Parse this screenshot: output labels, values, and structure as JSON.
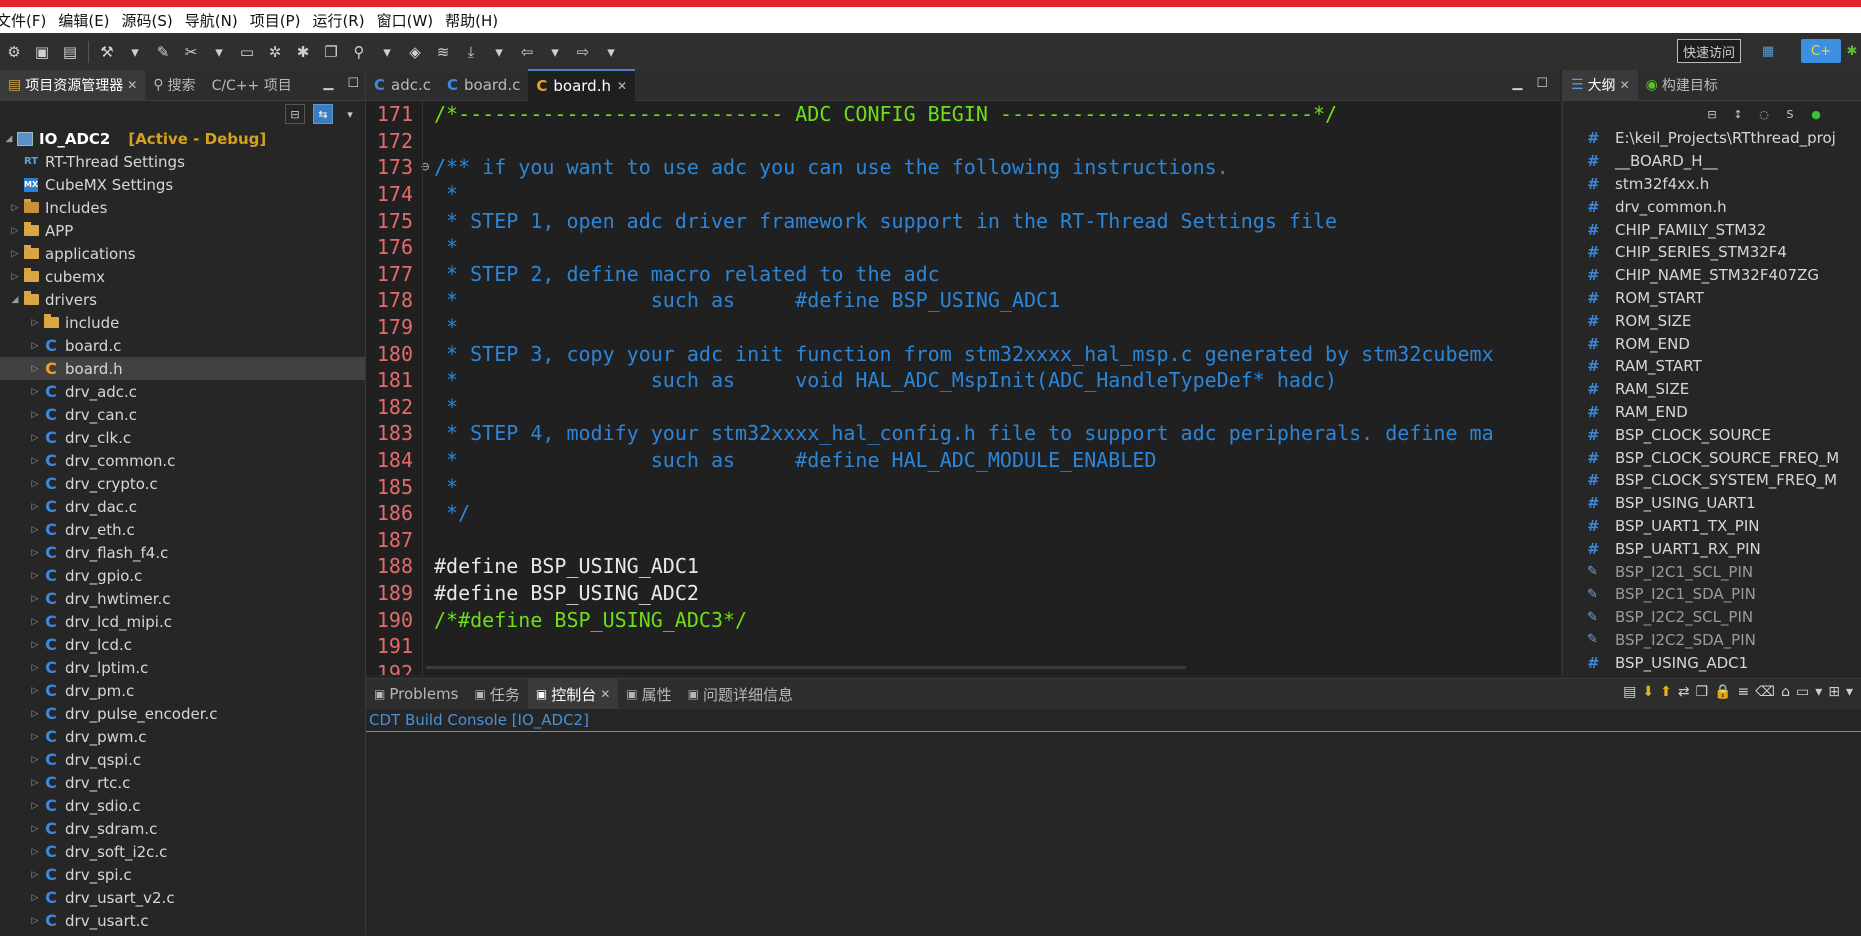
{
  "menu": [
    "文件(F)",
    "编辑(E)",
    "源码(S)",
    "导航(N)",
    "项目(P)",
    "运行(R)",
    "窗口(W)",
    "帮助(H)"
  ],
  "toolbar": {
    "quick_access": "快速访问"
  },
  "left_panel": {
    "tabs": [
      {
        "label": "项目资源管理器",
        "active": true
      },
      {
        "label": "搜索",
        "active": false
      },
      {
        "label": "C/C++ 项目",
        "active": false
      }
    ],
    "project": {
      "name": "IO_ADC2",
      "status": "[Active - Debug]"
    },
    "tree": [
      {
        "label": "RT-Thread Settings",
        "icon": "rt-thread-icon",
        "depth": 1,
        "arrow": ""
      },
      {
        "label": "CubeMX Settings",
        "icon": "cubemx-icon",
        "depth": 1,
        "arrow": ""
      },
      {
        "label": "Includes",
        "icon": "includes-icon",
        "depth": 1,
        "arrow": "▷"
      },
      {
        "label": "APP",
        "icon": "folder-icon",
        "depth": 1,
        "arrow": "▷"
      },
      {
        "label": "applications",
        "icon": "folder-icon",
        "depth": 1,
        "arrow": "▷"
      },
      {
        "label": "cubemx",
        "icon": "folder-icon",
        "depth": 1,
        "arrow": "▷"
      },
      {
        "label": "drivers",
        "icon": "folder-icon",
        "depth": 1,
        "arrow": "◢"
      },
      {
        "label": "include",
        "icon": "folder-icon",
        "depth": 2,
        "arrow": "▷"
      },
      {
        "label": "board.c",
        "icon": "c-file-icon",
        "depth": 2,
        "arrow": "▷"
      },
      {
        "label": "board.h",
        "icon": "h-file-icon",
        "depth": 2,
        "arrow": "▷",
        "selected": true
      },
      {
        "label": "drv_adc.c",
        "icon": "c-file-icon",
        "depth": 2,
        "arrow": "▷"
      },
      {
        "label": "drv_can.c",
        "icon": "c-file-icon",
        "depth": 2,
        "arrow": "▷"
      },
      {
        "label": "drv_clk.c",
        "icon": "c-file-icon",
        "depth": 2,
        "arrow": "▷"
      },
      {
        "label": "drv_common.c",
        "icon": "c-file-icon",
        "depth": 2,
        "arrow": "▷"
      },
      {
        "label": "drv_crypto.c",
        "icon": "c-file-icon",
        "depth": 2,
        "arrow": "▷"
      },
      {
        "label": "drv_dac.c",
        "icon": "c-file-icon",
        "depth": 2,
        "arrow": "▷"
      },
      {
        "label": "drv_eth.c",
        "icon": "c-file-icon",
        "depth": 2,
        "arrow": "▷"
      },
      {
        "label": "drv_flash_f4.c",
        "icon": "c-file-icon",
        "depth": 2,
        "arrow": "▷"
      },
      {
        "label": "drv_gpio.c",
        "icon": "c-file-icon",
        "depth": 2,
        "arrow": "▷"
      },
      {
        "label": "drv_hwtimer.c",
        "icon": "c-file-icon",
        "depth": 2,
        "arrow": "▷"
      },
      {
        "label": "drv_lcd_mipi.c",
        "icon": "c-file-icon",
        "depth": 2,
        "arrow": "▷"
      },
      {
        "label": "drv_lcd.c",
        "icon": "c-file-icon",
        "depth": 2,
        "arrow": "▷"
      },
      {
        "label": "drv_lptim.c",
        "icon": "c-file-icon",
        "depth": 2,
        "arrow": "▷"
      },
      {
        "label": "drv_pm.c",
        "icon": "c-file-icon",
        "depth": 2,
        "arrow": "▷"
      },
      {
        "label": "drv_pulse_encoder.c",
        "icon": "c-file-icon",
        "depth": 2,
        "arrow": "▷"
      },
      {
        "label": "drv_pwm.c",
        "icon": "c-file-icon",
        "depth": 2,
        "arrow": "▷"
      },
      {
        "label": "drv_qspi.c",
        "icon": "c-file-icon",
        "depth": 2,
        "arrow": "▷"
      },
      {
        "label": "drv_rtc.c",
        "icon": "c-file-icon",
        "depth": 2,
        "arrow": "▷"
      },
      {
        "label": "drv_sdio.c",
        "icon": "c-file-icon",
        "depth": 2,
        "arrow": "▷"
      },
      {
        "label": "drv_sdram.c",
        "icon": "c-file-icon",
        "depth": 2,
        "arrow": "▷"
      },
      {
        "label": "drv_soft_i2c.c",
        "icon": "c-file-icon",
        "depth": 2,
        "arrow": "▷"
      },
      {
        "label": "drv_spi.c",
        "icon": "c-file-icon",
        "depth": 2,
        "arrow": "▷"
      },
      {
        "label": "drv_usart_v2.c",
        "icon": "c-file-icon",
        "depth": 2,
        "arrow": "▷"
      },
      {
        "label": "drv_usart.c",
        "icon": "c-file-icon",
        "depth": 2,
        "arrow": "▷"
      }
    ]
  },
  "editor": {
    "tabs": [
      {
        "label": "adc.c",
        "active": false
      },
      {
        "label": "board.c",
        "active": false
      },
      {
        "label": "board.h",
        "active": true
      }
    ],
    "lines": [
      {
        "n": "171",
        "text": "/*--------------------------- ADC CONFIG BEGIN --------------------------*/",
        "style": "green"
      },
      {
        "n": "172",
        "text": "",
        "style": "com"
      },
      {
        "n": "173",
        "text": "/** if you want to use adc you can use the following instructions.",
        "style": "com",
        "fold": "⊖"
      },
      {
        "n": "174",
        "text": " *",
        "style": "com"
      },
      {
        "n": "175",
        "text": " * STEP 1, open adc driver framework support in the RT-Thread Settings file",
        "style": "com"
      },
      {
        "n": "176",
        "text": " *",
        "style": "com"
      },
      {
        "n": "177",
        "text": " * STEP 2, define macro related to the adc",
        "style": "com"
      },
      {
        "n": "178",
        "text": " *                such as     #define BSP_USING_ADC1",
        "style": "com"
      },
      {
        "n": "179",
        "text": " *",
        "style": "com"
      },
      {
        "n": "180",
        "text": " * STEP 3, copy your adc init function from stm32xxxx_hal_msp.c generated by stm32cubemx",
        "style": "com"
      },
      {
        "n": "181",
        "text": " *                such as     void HAL_ADC_MspInit(ADC_HandleTypeDef* hadc)",
        "style": "com"
      },
      {
        "n": "182",
        "text": " *",
        "style": "com"
      },
      {
        "n": "183",
        "text": " * STEP 4, modify your stm32xxxx_hal_config.h file to support adc peripherals. define ma",
        "style": "com"
      },
      {
        "n": "184",
        "text": " *                such as     #define HAL_ADC_MODULE_ENABLED",
        "style": "com"
      },
      {
        "n": "185",
        "text": " *",
        "style": "com"
      },
      {
        "n": "186",
        "text": " */",
        "style": "com"
      },
      {
        "n": "187",
        "text": "",
        "style": "com"
      },
      {
        "n": "188",
        "text": "#define BSP_USING_ADC1",
        "style": "def"
      },
      {
        "n": "189",
        "text": "#define BSP_USING_ADC2",
        "style": "def"
      },
      {
        "n": "190",
        "text": "/*#define BSP_USING_ADC3*/",
        "style": "green"
      },
      {
        "n": "191",
        "text": "",
        "style": "com"
      },
      {
        "n": "192",
        "text": "",
        "style": "com"
      }
    ]
  },
  "outline": {
    "tabs": [
      {
        "label": "大纲",
        "active": true
      },
      {
        "label": "构建目标",
        "active": false
      }
    ],
    "items": [
      {
        "label": "E:\\keil_Projects\\RTthread_proj",
        "kind": "include"
      },
      {
        "label": "__BOARD_H__",
        "kind": "macro"
      },
      {
        "label": "stm32f4xx.h",
        "kind": "include"
      },
      {
        "label": "drv_common.h",
        "kind": "include"
      },
      {
        "label": "CHIP_FAMILY_STM32",
        "kind": "macro"
      },
      {
        "label": "CHIP_SERIES_STM32F4",
        "kind": "macro"
      },
      {
        "label": "CHIP_NAME_STM32F407ZG",
        "kind": "macro"
      },
      {
        "label": "ROM_START",
        "kind": "macro"
      },
      {
        "label": "ROM_SIZE",
        "kind": "macro"
      },
      {
        "label": "ROM_END",
        "kind": "macro"
      },
      {
        "label": "RAM_START",
        "kind": "macro"
      },
      {
        "label": "RAM_SIZE",
        "kind": "macro"
      },
      {
        "label": "RAM_END",
        "kind": "macro"
      },
      {
        "label": "BSP_CLOCK_SOURCE",
        "kind": "macro"
      },
      {
        "label": "BSP_CLOCK_SOURCE_FREQ_M",
        "kind": "macro"
      },
      {
        "label": "BSP_CLOCK_SYSTEM_FREQ_M",
        "kind": "macro"
      },
      {
        "label": "BSP_USING_UART1",
        "kind": "macro"
      },
      {
        "label": "BSP_UART1_TX_PIN",
        "kind": "macro"
      },
      {
        "label": "BSP_UART1_RX_PIN",
        "kind": "macro"
      },
      {
        "label": "BSP_I2C1_SCL_PIN",
        "kind": "disabled"
      },
      {
        "label": "BSP_I2C1_SDA_PIN",
        "kind": "disabled"
      },
      {
        "label": "BSP_I2C2_SCL_PIN",
        "kind": "disabled"
      },
      {
        "label": "BSP_I2C2_SDA_PIN",
        "kind": "disabled"
      },
      {
        "label": "BSP_USING_ADC1",
        "kind": "macro"
      }
    ]
  },
  "console": {
    "tabs": [
      {
        "label": "Problems",
        "active": false
      },
      {
        "label": "任务",
        "active": false
      },
      {
        "label": "控制台",
        "active": true
      },
      {
        "label": "属性",
        "active": false
      },
      {
        "label": "问题详细信息",
        "active": false
      }
    ],
    "title": "CDT Build Console [IO_ADC2]"
  },
  "colors": {
    "accent_red": "#e5232a",
    "line_numbers": "#e26c6c",
    "comment": "#2b86d9",
    "define": "#e8e8e8",
    "green_comment": "#6fdd1a"
  }
}
